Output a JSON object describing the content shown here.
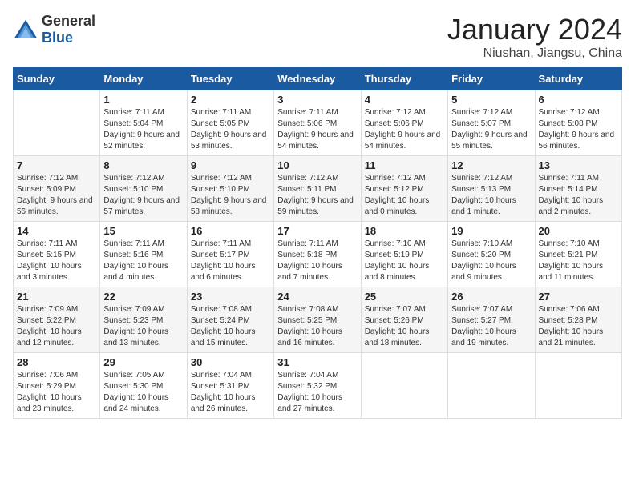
{
  "logo": {
    "general": "General",
    "blue": "Blue"
  },
  "header": {
    "month": "January 2024",
    "location": "Niushan, Jiangsu, China"
  },
  "weekdays": [
    "Sunday",
    "Monday",
    "Tuesday",
    "Wednesday",
    "Thursday",
    "Friday",
    "Saturday"
  ],
  "weeks": [
    [
      {
        "day": "",
        "sunrise": "",
        "sunset": "",
        "daylight": ""
      },
      {
        "day": "1",
        "sunrise": "Sunrise: 7:11 AM",
        "sunset": "Sunset: 5:04 PM",
        "daylight": "Daylight: 9 hours and 52 minutes."
      },
      {
        "day": "2",
        "sunrise": "Sunrise: 7:11 AM",
        "sunset": "Sunset: 5:05 PM",
        "daylight": "Daylight: 9 hours and 53 minutes."
      },
      {
        "day": "3",
        "sunrise": "Sunrise: 7:11 AM",
        "sunset": "Sunset: 5:06 PM",
        "daylight": "Daylight: 9 hours and 54 minutes."
      },
      {
        "day": "4",
        "sunrise": "Sunrise: 7:12 AM",
        "sunset": "Sunset: 5:06 PM",
        "daylight": "Daylight: 9 hours and 54 minutes."
      },
      {
        "day": "5",
        "sunrise": "Sunrise: 7:12 AM",
        "sunset": "Sunset: 5:07 PM",
        "daylight": "Daylight: 9 hours and 55 minutes."
      },
      {
        "day": "6",
        "sunrise": "Sunrise: 7:12 AM",
        "sunset": "Sunset: 5:08 PM",
        "daylight": "Daylight: 9 hours and 56 minutes."
      }
    ],
    [
      {
        "day": "7",
        "sunrise": "Sunrise: 7:12 AM",
        "sunset": "Sunset: 5:09 PM",
        "daylight": "Daylight: 9 hours and 56 minutes."
      },
      {
        "day": "8",
        "sunrise": "Sunrise: 7:12 AM",
        "sunset": "Sunset: 5:10 PM",
        "daylight": "Daylight: 9 hours and 57 minutes."
      },
      {
        "day": "9",
        "sunrise": "Sunrise: 7:12 AM",
        "sunset": "Sunset: 5:10 PM",
        "daylight": "Daylight: 9 hours and 58 minutes."
      },
      {
        "day": "10",
        "sunrise": "Sunrise: 7:12 AM",
        "sunset": "Sunset: 5:11 PM",
        "daylight": "Daylight: 9 hours and 59 minutes."
      },
      {
        "day": "11",
        "sunrise": "Sunrise: 7:12 AM",
        "sunset": "Sunset: 5:12 PM",
        "daylight": "Daylight: 10 hours and 0 minutes."
      },
      {
        "day": "12",
        "sunrise": "Sunrise: 7:12 AM",
        "sunset": "Sunset: 5:13 PM",
        "daylight": "Daylight: 10 hours and 1 minute."
      },
      {
        "day": "13",
        "sunrise": "Sunrise: 7:11 AM",
        "sunset": "Sunset: 5:14 PM",
        "daylight": "Daylight: 10 hours and 2 minutes."
      }
    ],
    [
      {
        "day": "14",
        "sunrise": "Sunrise: 7:11 AM",
        "sunset": "Sunset: 5:15 PM",
        "daylight": "Daylight: 10 hours and 3 minutes."
      },
      {
        "day": "15",
        "sunrise": "Sunrise: 7:11 AM",
        "sunset": "Sunset: 5:16 PM",
        "daylight": "Daylight: 10 hours and 4 minutes."
      },
      {
        "day": "16",
        "sunrise": "Sunrise: 7:11 AM",
        "sunset": "Sunset: 5:17 PM",
        "daylight": "Daylight: 10 hours and 6 minutes."
      },
      {
        "day": "17",
        "sunrise": "Sunrise: 7:11 AM",
        "sunset": "Sunset: 5:18 PM",
        "daylight": "Daylight: 10 hours and 7 minutes."
      },
      {
        "day": "18",
        "sunrise": "Sunrise: 7:10 AM",
        "sunset": "Sunset: 5:19 PM",
        "daylight": "Daylight: 10 hours and 8 minutes."
      },
      {
        "day": "19",
        "sunrise": "Sunrise: 7:10 AM",
        "sunset": "Sunset: 5:20 PM",
        "daylight": "Daylight: 10 hours and 9 minutes."
      },
      {
        "day": "20",
        "sunrise": "Sunrise: 7:10 AM",
        "sunset": "Sunset: 5:21 PM",
        "daylight": "Daylight: 10 hours and 11 minutes."
      }
    ],
    [
      {
        "day": "21",
        "sunrise": "Sunrise: 7:09 AM",
        "sunset": "Sunset: 5:22 PM",
        "daylight": "Daylight: 10 hours and 12 minutes."
      },
      {
        "day": "22",
        "sunrise": "Sunrise: 7:09 AM",
        "sunset": "Sunset: 5:23 PM",
        "daylight": "Daylight: 10 hours and 13 minutes."
      },
      {
        "day": "23",
        "sunrise": "Sunrise: 7:08 AM",
        "sunset": "Sunset: 5:24 PM",
        "daylight": "Daylight: 10 hours and 15 minutes."
      },
      {
        "day": "24",
        "sunrise": "Sunrise: 7:08 AM",
        "sunset": "Sunset: 5:25 PM",
        "daylight": "Daylight: 10 hours and 16 minutes."
      },
      {
        "day": "25",
        "sunrise": "Sunrise: 7:07 AM",
        "sunset": "Sunset: 5:26 PM",
        "daylight": "Daylight: 10 hours and 18 minutes."
      },
      {
        "day": "26",
        "sunrise": "Sunrise: 7:07 AM",
        "sunset": "Sunset: 5:27 PM",
        "daylight": "Daylight: 10 hours and 19 minutes."
      },
      {
        "day": "27",
        "sunrise": "Sunrise: 7:06 AM",
        "sunset": "Sunset: 5:28 PM",
        "daylight": "Daylight: 10 hours and 21 minutes."
      }
    ],
    [
      {
        "day": "28",
        "sunrise": "Sunrise: 7:06 AM",
        "sunset": "Sunset: 5:29 PM",
        "daylight": "Daylight: 10 hours and 23 minutes."
      },
      {
        "day": "29",
        "sunrise": "Sunrise: 7:05 AM",
        "sunset": "Sunset: 5:30 PM",
        "daylight": "Daylight: 10 hours and 24 minutes."
      },
      {
        "day": "30",
        "sunrise": "Sunrise: 7:04 AM",
        "sunset": "Sunset: 5:31 PM",
        "daylight": "Daylight: 10 hours and 26 minutes."
      },
      {
        "day": "31",
        "sunrise": "Sunrise: 7:04 AM",
        "sunset": "Sunset: 5:32 PM",
        "daylight": "Daylight: 10 hours and 27 minutes."
      },
      {
        "day": "",
        "sunrise": "",
        "sunset": "",
        "daylight": ""
      },
      {
        "day": "",
        "sunrise": "",
        "sunset": "",
        "daylight": ""
      },
      {
        "day": "",
        "sunrise": "",
        "sunset": "",
        "daylight": ""
      }
    ]
  ]
}
